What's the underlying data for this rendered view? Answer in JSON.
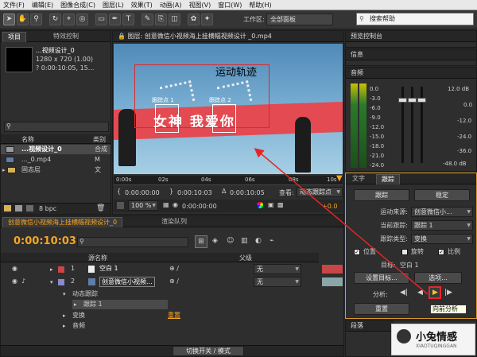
{
  "menu": [
    "文件(F)",
    "编辑(E)",
    "图像合成(C)",
    "图层(L)",
    "效果(T)",
    "动画(A)",
    "视图(V)",
    "窗口(W)",
    "帮助(H)"
  ],
  "toolbar": {
    "workspace_label": "工作区:",
    "workspace_value": "全部面板",
    "search_placeholder": "搜索帮助"
  },
  "project": {
    "tabs": [
      "项目",
      "特效控制"
    ],
    "item_name": "...视频设计_0",
    "item_info_1": "1280 x 720 (1.00)",
    "item_info_2": "? 0:00:10:05, 15...",
    "search_placeholder": "",
    "col_name": "名称",
    "col_type": "类别",
    "rows": [
      {
        "name": "...视频设计_0",
        "type": "合成",
        "selected": true
      },
      {
        "name": "..._0.mp4",
        "type": "M"
      },
      {
        "name": "固态层",
        "type": "文"
      }
    ],
    "bpc": "8 bpc"
  },
  "viewer": {
    "title": "图层: 创意微信小视频海上挂横幅视频设计 _0.mp4",
    "annotation": "运动轨迹",
    "banner_text": "女神   我爱你",
    "track_point_1": "跟踪点 1",
    "track_point_2": "跟踪点 2",
    "ruler": [
      "0:00s",
      "02s",
      "04s",
      "06s",
      "08s",
      "10s"
    ],
    "time_start": "0:00:00:00",
    "time_end": "0:00:10:03",
    "time_duration": "0:00:10:05",
    "view_label": "查看:",
    "view_value": "动态跟踪点",
    "zoom": "100 %",
    "res": "0:00:00:00",
    "offset": "+0.0"
  },
  "timeline": {
    "tabs": [
      "创意微信小视频海上挂横幅视频设计_0",
      "渲染队列"
    ],
    "timecode": "0:00:10:03",
    "search_placeholder": "",
    "col_source": "源名称",
    "col_parent": "父级",
    "layers": [
      {
        "num": "1",
        "name": "空白 1",
        "parent": "无",
        "color": "#c94646"
      },
      {
        "num": "2",
        "name": "创意微信小视频...",
        "parent": "无",
        "color": "#8a8ad0"
      }
    ],
    "sub_rows": [
      {
        "label": "动态跟踪",
        "indent": 1
      },
      {
        "label": "跟踪 1",
        "indent": 2
      },
      {
        "label": "变换",
        "indent": 1,
        "value": "重置"
      },
      {
        "label": "音频",
        "indent": 1
      }
    ],
    "footer": "切换开关 / 模式"
  },
  "right": {
    "preview_title": "预览控制台",
    "info_title": "信息",
    "audio_title": "音频",
    "audio_values": [
      "0.0",
      "-3.0",
      "-6.0",
      "-9.0",
      "-12.0",
      "-15.0",
      "-18.0",
      "-21.0",
      "-24.0"
    ],
    "audio_db": [
      "12.0 dB",
      "0.0",
      "-12.0",
      "-24.0",
      "-36.0",
      "-48.0 dB"
    ],
    "tabs": [
      "文字",
      "跟踪"
    ],
    "track_btn": "跟踪",
    "stabilize_btn": "稳定",
    "motion_source_label": "运动来源:",
    "motion_source_value": "创意微信小...",
    "current_track_label": "当前跟踪:",
    "current_track_value": "跟踪 1",
    "track_type_label": "跟踪类型:",
    "track_type_value": "变换",
    "position_label": "位置",
    "rotation_label": "旋转",
    "scale_label": "比例",
    "target_label": "目标:",
    "target_value": "空白 1",
    "set_target_btn": "设置目标...",
    "options_btn": "选项...",
    "analyze_label": "分析:",
    "reset_btn": "重置",
    "tooltip": "向前分析",
    "para_title": "段落"
  },
  "watermark": {
    "name": "小兔情感",
    "sub": "XIAOTUQINGGAN"
  }
}
